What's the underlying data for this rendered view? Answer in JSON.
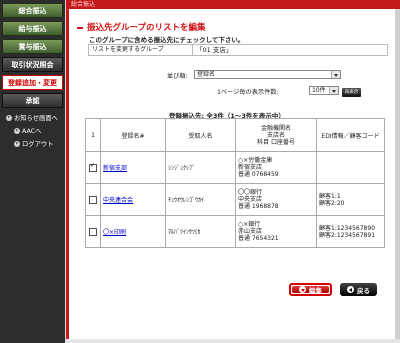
{
  "sidebar": {
    "items": [
      {
        "label": "総合振込"
      },
      {
        "label": "給与振込"
      },
      {
        "label": "賞与振込"
      },
      {
        "label": "取引状況照会"
      },
      {
        "label": "登録追加・変更"
      },
      {
        "label": "承認"
      }
    ],
    "links": [
      {
        "label": "お知らせ画面へ"
      },
      {
        "label": "AACへ"
      },
      {
        "label": "ログアウト"
      }
    ]
  },
  "header": {
    "breadcrumb": "総合振込"
  },
  "page": {
    "title": "振込先グループのリストを編集",
    "instruction": "このグループに含める振込先にチェックして下さい。",
    "group_label": "リストを変更するグループ",
    "group_value": "「01 支店」"
  },
  "controls": {
    "sort_label": "並び順:",
    "sort_value": "登録名",
    "per_page_label": "1ページ毎の表示件数:",
    "per_page_value": "10件",
    "show_button": "再表示"
  },
  "summary": {
    "count_text": "登録振込先: 全3件（1～3件を表示中）"
  },
  "table": {
    "headers": [
      "1",
      "登録名#",
      "受取人名",
      "金融機関名\n支店名\n科目 口座番号",
      "EDI情報／顧客コード"
    ],
    "rows": [
      {
        "checked": true,
        "name": "新宿支部",
        "payee": "ｼﾝｼﾞｭｸｼﾌﾞ",
        "bank": "○×労働金庫\n新宿支店\n普通 0768459",
        "edi": ""
      },
      {
        "checked": false,
        "name": "中央連合会",
        "payee": "ﾁｭｳｵｳﾚﾝｺﾞｳｶｲ",
        "bank": "〇〇銀行\n中央支店\n普通 1968878",
        "edi": "顧客1:1\n顧客2:20"
      },
      {
        "checked": false,
        "name": "〇×印刷",
        "payee": "ﾏﾙﾊﾞﾂｲﾝｻﾂ(ｶ",
        "bank": "○×銀行\n赤山支店\n普通 7654321",
        "edi": "顧客1:1234567890\n顧客2:1234567891"
      }
    ]
  },
  "actions": {
    "edit": "編集",
    "back": "戻る"
  },
  "colors": {
    "accent": "#c41a1a",
    "nav_green": "#5a7a3e",
    "sidebar_bg": "#2d2d2d"
  }
}
